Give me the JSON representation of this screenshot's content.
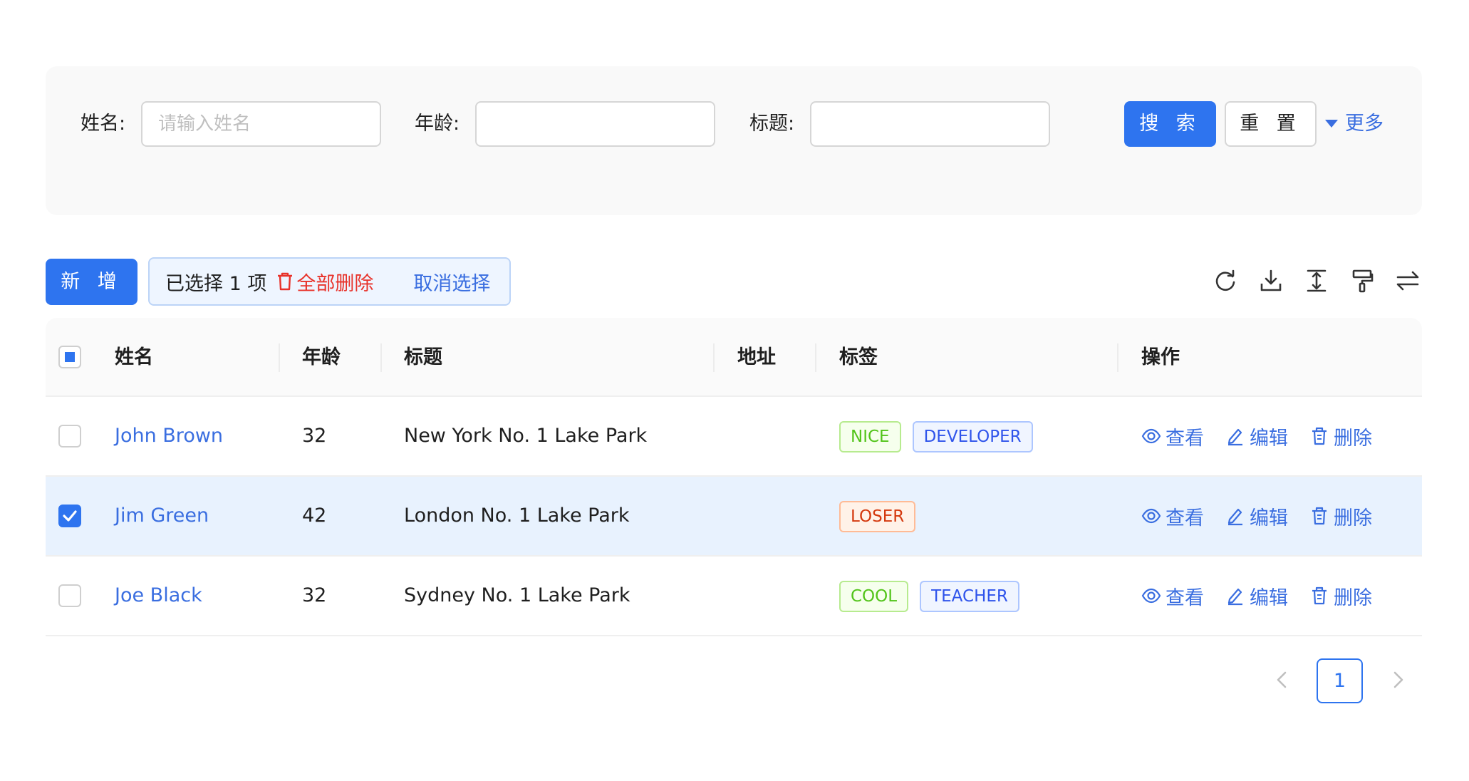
{
  "search": {
    "name_label": "姓名:",
    "name_placeholder": "请输入姓名",
    "name_value": "",
    "age_label": "年龄:",
    "age_value": "",
    "title_label": "标题:",
    "title_value": "",
    "search_button": "搜 索",
    "reset_button": "重 置",
    "more_link": "更多"
  },
  "toolbar": {
    "add_button": "新 增",
    "selected_text": "已选择 1 项",
    "delete_all": "全部删除",
    "cancel_selection": "取消选择",
    "icons": [
      "reload-icon",
      "download-icon",
      "column-height-icon",
      "format-painter-icon",
      "swap-icon"
    ]
  },
  "table": {
    "header_checkbox": "indeterminate",
    "columns": [
      "姓名",
      "年龄",
      "标题",
      "地址",
      "标签",
      "操作"
    ],
    "rows": [
      {
        "checked": false,
        "name": "John Brown",
        "age": "32",
        "title": "New York No. 1 Lake Park",
        "address": "",
        "tags": [
          {
            "label": "NICE",
            "color": "#52c41a",
            "bg": "#f6ffed",
            "border": "#b7eb8f"
          },
          {
            "label": "DEVELOPER",
            "color": "#2f54eb",
            "bg": "#f0f5ff",
            "border": "#adc6ff"
          }
        ]
      },
      {
        "checked": true,
        "name": "Jim Green",
        "age": "42",
        "title": "London No. 1 Lake Park",
        "address": "",
        "tags": [
          {
            "label": "LOSER",
            "color": "#d4380d",
            "bg": "#fff2e8",
            "border": "#ffbb96"
          }
        ]
      },
      {
        "checked": false,
        "name": "Joe Black",
        "age": "32",
        "title": "Sydney No. 1 Lake Park",
        "address": "",
        "tags": [
          {
            "label": "COOL",
            "color": "#52c41a",
            "bg": "#f6ffed",
            "border": "#b7eb8f"
          },
          {
            "label": "TEACHER",
            "color": "#2f54eb",
            "bg": "#f0f5ff",
            "border": "#adc6ff"
          }
        ]
      }
    ],
    "actions": {
      "view": "查看",
      "edit": "编辑",
      "delete": "删除"
    }
  },
  "pagination": {
    "current_page": "1"
  },
  "colors": {
    "primary": "#2e74ef",
    "link": "#3a6ee0",
    "danger": "#e8322a",
    "selected_row": "#e8f2fe"
  }
}
